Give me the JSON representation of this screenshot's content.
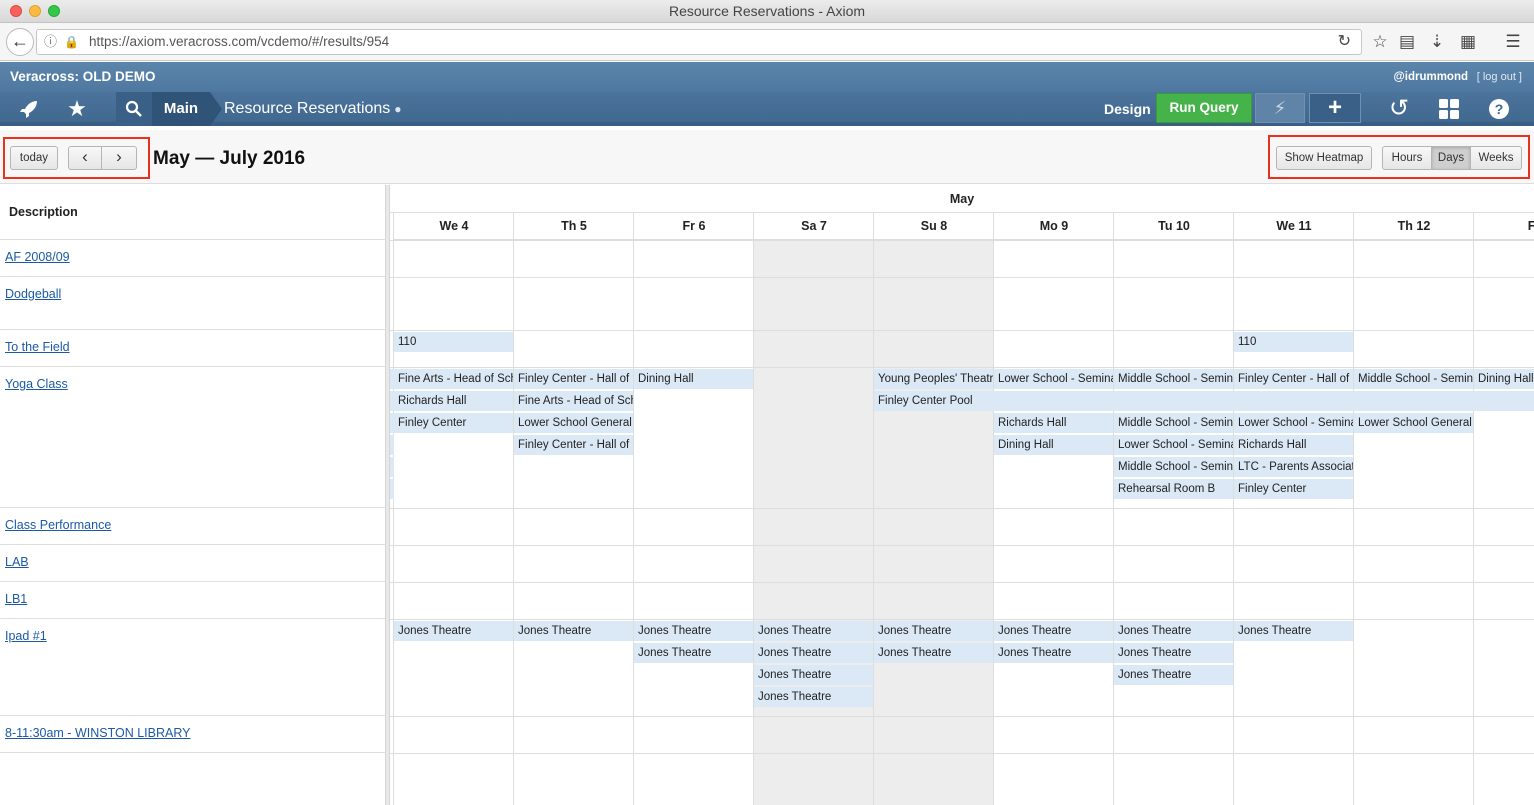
{
  "window": {
    "title": "Resource Reservations - Axiom"
  },
  "browser": {
    "url": "https://axiom.veracross.com/vcdemo/#/results/954"
  },
  "app": {
    "name": "Veracross: OLD DEMO",
    "user": "@idrummond",
    "logout": "[ log out ]"
  },
  "nav": {
    "main_label": "Main",
    "page_title": "Resource Reservations",
    "dot": "●",
    "design_label": "Design",
    "run_query_label": "Run Query",
    "bolt_glyph": "⚡",
    "plus_glyph": "+"
  },
  "calendar": {
    "today_label": "today",
    "prev_glyph": "‹",
    "next_glyph": "›",
    "range_title": "May — July 2016",
    "heatmap_label": "Show Heatmap",
    "view_hours": "Hours",
    "view_days": "Days",
    "view_weeks": "Weeks",
    "active_view": "Days",
    "month_label": "May",
    "description_header": "Description"
  },
  "days": [
    {
      "label": "We 4",
      "weekend": false
    },
    {
      "label": "Th 5",
      "weekend": false
    },
    {
      "label": "Fr 6",
      "weekend": false
    },
    {
      "label": "Sa 7",
      "weekend": true
    },
    {
      "label": "Su 8",
      "weekend": true
    },
    {
      "label": "Mo 9",
      "weekend": false
    },
    {
      "label": "Tu 10",
      "weekend": false
    },
    {
      "label": "We 11",
      "weekend": false
    },
    {
      "label": "Th 12",
      "weekend": false
    },
    {
      "label": "Fr",
      "weekend": false
    }
  ],
  "rows": [
    {
      "label": "AF 2008/09"
    },
    {
      "label": "Dodgeball"
    },
    {
      "label": "To the Field"
    },
    {
      "label": "Yoga Class"
    },
    {
      "label": "Class Performance"
    },
    {
      "label": "LAB"
    },
    {
      "label": "LB1"
    },
    {
      "label": "Ipad #1"
    },
    {
      "label": "8-11:30am - WINSTON LIBRARY"
    }
  ],
  "events": [
    {
      "row": 2,
      "day": 0,
      "slot": 0,
      "text": "110"
    },
    {
      "row": 2,
      "day": 7,
      "slot": 0,
      "text": "110"
    },
    {
      "row": 3,
      "day": 0,
      "slot": 0,
      "text": "Fine Arts - Head of School"
    },
    {
      "row": 3,
      "day": 0,
      "slot": 1,
      "text": "Richards Hall"
    },
    {
      "row": 3,
      "day": 0,
      "slot": 2,
      "text": "Finley Center"
    },
    {
      "row": 3,
      "day": 1,
      "slot": 0,
      "text": "Finley Center - Hall of Fame"
    },
    {
      "row": 3,
      "day": 1,
      "slot": 1,
      "text": "Fine Arts - Head of School"
    },
    {
      "row": 3,
      "day": 1,
      "slot": 2,
      "text": "Lower School General Meeting"
    },
    {
      "row": 3,
      "day": 1,
      "slot": 3,
      "text": "Finley Center - Hall of Fame"
    },
    {
      "row": 3,
      "day": 2,
      "slot": 0,
      "text": "Dining Hall"
    },
    {
      "row": 3,
      "day": 4,
      "slot": 0,
      "text": "Young Peoples' Theatre"
    },
    {
      "row": 3,
      "day": 4,
      "slot": 1,
      "text": "Finley Center Pool",
      "span": 6
    },
    {
      "row": 3,
      "day": 5,
      "slot": 0,
      "text": "Lower School - Seminar"
    },
    {
      "row": 3,
      "day": 5,
      "slot": 2,
      "text": "Richards Hall"
    },
    {
      "row": 3,
      "day": 5,
      "slot": 3,
      "text": "Dining Hall"
    },
    {
      "row": 3,
      "day": 6,
      "slot": 0,
      "text": "Middle School - Seminar"
    },
    {
      "row": 3,
      "day": 6,
      "slot": 2,
      "text": "Middle School - Seminar"
    },
    {
      "row": 3,
      "day": 6,
      "slot": 3,
      "text": "Lower School - Seminar"
    },
    {
      "row": 3,
      "day": 6,
      "slot": 4,
      "text": "Middle School - Seminar"
    },
    {
      "row": 3,
      "day": 6,
      "slot": 5,
      "text": "Rehearsal Room B"
    },
    {
      "row": 3,
      "day": 7,
      "slot": 0,
      "text": "Finley Center - Hall of Fame"
    },
    {
      "row": 3,
      "day": 7,
      "slot": 2,
      "text": "Lower School - Seminar"
    },
    {
      "row": 3,
      "day": 7,
      "slot": 3,
      "text": "Richards Hall"
    },
    {
      "row": 3,
      "day": 7,
      "slot": 4,
      "text": "LTC - Parents Association"
    },
    {
      "row": 3,
      "day": 7,
      "slot": 5,
      "text": "Finley Center"
    },
    {
      "row": 3,
      "day": 8,
      "slot": 0,
      "text": "Middle School - Seminar"
    },
    {
      "row": 3,
      "day": 8,
      "slot": 2,
      "text": "Lower School General Meeting"
    },
    {
      "row": 3,
      "day": 9,
      "slot": 0,
      "text": "Dining Hall"
    },
    {
      "row": 7,
      "day": 0,
      "slot": 0,
      "text": "Jones Theatre"
    },
    {
      "row": 7,
      "day": 1,
      "slot": 0,
      "text": "Jones Theatre"
    },
    {
      "row": 7,
      "day": 2,
      "slot": 0,
      "text": "Jones Theatre"
    },
    {
      "row": 7,
      "day": 2,
      "slot": 1,
      "text": "Jones Theatre"
    },
    {
      "row": 7,
      "day": 3,
      "slot": 0,
      "text": "Jones Theatre"
    },
    {
      "row": 7,
      "day": 3,
      "slot": 1,
      "text": "Jones Theatre"
    },
    {
      "row": 7,
      "day": 3,
      "slot": 2,
      "text": "Jones Theatre"
    },
    {
      "row": 7,
      "day": 3,
      "slot": 3,
      "text": "Jones Theatre"
    },
    {
      "row": 7,
      "day": 4,
      "slot": 0,
      "text": "Jones Theatre"
    },
    {
      "row": 7,
      "day": 4,
      "slot": 1,
      "text": "Jones Theatre"
    },
    {
      "row": 7,
      "day": 5,
      "slot": 0,
      "text": "Jones Theatre"
    },
    {
      "row": 7,
      "day": 5,
      "slot": 1,
      "text": "Jones Theatre"
    },
    {
      "row": 7,
      "day": 6,
      "slot": 0,
      "text": "Jones Theatre"
    },
    {
      "row": 7,
      "day": 6,
      "slot": 1,
      "text": "Jones Theatre"
    },
    {
      "row": 7,
      "day": 6,
      "slot": 2,
      "text": "Jones Theatre"
    },
    {
      "row": 7,
      "day": 7,
      "slot": 0,
      "text": "Jones Theatre"
    }
  ],
  "colors": {
    "event_bg": "#dbe8f6",
    "weekend_bg": "#ededed",
    "run_query": "#46b34a",
    "highlight": "#e8321d",
    "link": "#1c5aa6"
  },
  "icons": [
    "back-arrow-icon",
    "info-icon",
    "lock-icon",
    "reload-icon",
    "star-icon",
    "reading-list-icon",
    "download-icon",
    "extension-icon",
    "menu-icon",
    "rocket-icon",
    "favorite-star-icon",
    "search-icon",
    "history-icon",
    "grid-icon",
    "help-icon"
  ]
}
